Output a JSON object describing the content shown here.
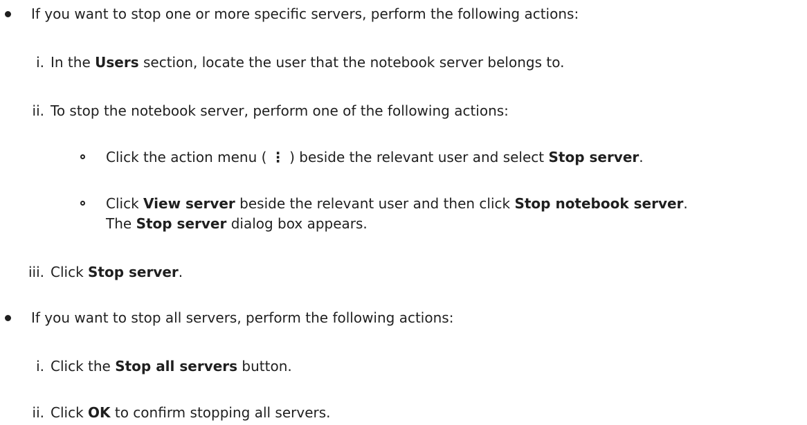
{
  "items": [
    {
      "intro": "If you want to stop one or more specific servers, perform the following actions:",
      "steps": [
        {
          "num": "i.",
          "p1": "In the ",
          "b1": "Users",
          "p2": " section, locate the user that the notebook server belongs to."
        },
        {
          "num": "ii.",
          "text": "To stop the notebook server, perform one of the following actions:",
          "sub": [
            {
              "p1": "Click the action menu (",
              "kebab": "⋮",
              "p2": ") beside the relevant user and select ",
              "b1": "Stop server",
              "p3": "."
            },
            {
              "p1": "Click ",
              "b1": "View server",
              "p2": " beside the relevant user and then click ",
              "b2": "Stop notebook server",
              "p3": ".",
              "l2_p1": "The ",
              "l2_b1": "Stop server",
              "l2_p2": " dialog box appears."
            }
          ]
        },
        {
          "num": "iii.",
          "p1": "Click ",
          "b1": "Stop server",
          "p2": "."
        }
      ]
    },
    {
      "intro": "If you want to stop all servers, perform the following actions:",
      "steps": [
        {
          "num": "i.",
          "p1": "Click the ",
          "b1": "Stop all servers",
          "p2": " button."
        },
        {
          "num": "ii.",
          "p1": "Click ",
          "b1": "OK",
          "p2": " to confirm stopping all servers."
        }
      ]
    }
  ]
}
